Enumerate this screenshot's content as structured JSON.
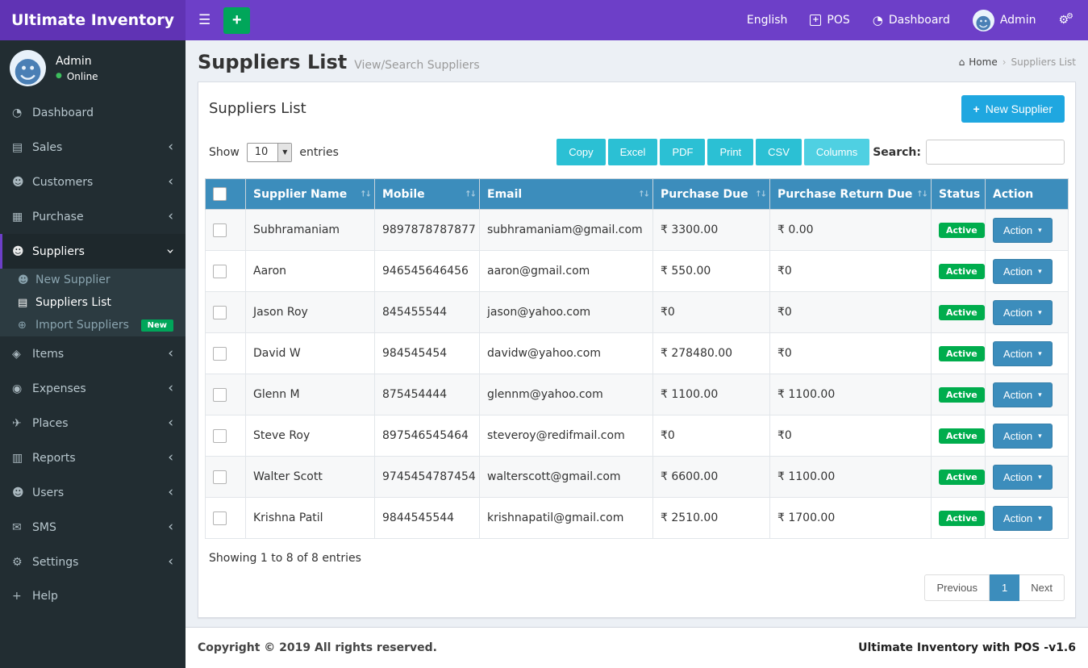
{
  "colors": {
    "navbar": "#6d3fc8",
    "brand_bg": "#6033b4",
    "sidebar_bg": "#222d32",
    "accent_blue": "#3c8dbc",
    "export_teal": "#2bc0d4",
    "success_green": "#00a65a",
    "new_supplier_blue": "#1fa7e0",
    "badge_green": "#00ad4d"
  },
  "icons": {
    "hamburger": "☰",
    "plus": "+",
    "user": "☻",
    "gear": "⚙",
    "home": "⌂",
    "breadcrumb_sep": "›",
    "chevron": "‹",
    "caret_down": "▾",
    "sort": "↑↓",
    "online_dot": "●",
    "select_arrow": "▼"
  },
  "brand": {
    "title": "Ultimate Inventory"
  },
  "navbar": {
    "language": "English",
    "pos_label": "POS",
    "dashboard_label": "Dashboard",
    "user_name": "Admin"
  },
  "sidebar": {
    "user": {
      "name": "Admin",
      "status": "Online"
    },
    "items": [
      {
        "label": "Dashboard",
        "icon": "◔"
      },
      {
        "label": "Sales",
        "icon": "▤"
      },
      {
        "label": "Customers",
        "icon": "☻"
      },
      {
        "label": "Purchase",
        "icon": "▦"
      },
      {
        "label": "Suppliers",
        "icon": "☻"
      },
      {
        "label": "Items",
        "icon": "◈"
      },
      {
        "label": "Expenses",
        "icon": "◉"
      },
      {
        "label": "Places",
        "icon": "✈"
      },
      {
        "label": "Reports",
        "icon": "▥"
      },
      {
        "label": "Users",
        "icon": "☻"
      },
      {
        "label": "SMS",
        "icon": "✉"
      },
      {
        "label": "Settings",
        "icon": "⚙"
      },
      {
        "label": "Help",
        "icon": "+"
      }
    ],
    "suppliers_submenu": [
      {
        "label": "New Supplier",
        "icon": "☻"
      },
      {
        "label": "Suppliers List",
        "icon": "▤"
      },
      {
        "label": "Import Suppliers",
        "icon": "⊕",
        "badge": "New"
      }
    ]
  },
  "page": {
    "title": "Suppliers List",
    "subtitle": "View/Search Suppliers",
    "breadcrumb": {
      "home": "Home",
      "current": "Suppliers List"
    }
  },
  "card": {
    "title": "Suppliers List",
    "new_supplier_label": "New Supplier"
  },
  "controls": {
    "show_label": "Show",
    "entries_label": "entries",
    "page_length": "10",
    "export_buttons": [
      "Copy",
      "Excel",
      "PDF",
      "Print",
      "CSV",
      "Columns"
    ],
    "search_label": "Search:"
  },
  "table": {
    "headers": [
      "Supplier Name",
      "Mobile",
      "Email",
      "Purchase Due",
      "Purchase Return Due",
      "Status",
      "Action"
    ],
    "rows": [
      {
        "name": "Subhramaniam",
        "mobile": "9897878787877",
        "email": "subhramaniam@gmail.com",
        "purchase_due": "₹ 3300.00",
        "purchase_return_due": "₹ 0.00",
        "status": "Active",
        "action": "Action"
      },
      {
        "name": "Aaron",
        "mobile": "946545646456",
        "email": "aaron@gmail.com",
        "purchase_due": "₹ 550.00",
        "purchase_return_due": "₹0",
        "status": "Active",
        "action": "Action"
      },
      {
        "name": "Jason Roy",
        "mobile": "845455544",
        "email": "jason@yahoo.com",
        "purchase_due": "₹0",
        "purchase_return_due": "₹0",
        "status": "Active",
        "action": "Action"
      },
      {
        "name": "David W",
        "mobile": "984545454",
        "email": "davidw@yahoo.com",
        "purchase_due": "₹ 278480.00",
        "purchase_return_due": "₹0",
        "status": "Active",
        "action": "Action"
      },
      {
        "name": "Glenn M",
        "mobile": "875454444",
        "email": "glennm@yahoo.com",
        "purchase_due": "₹ 1100.00",
        "purchase_return_due": "₹ 1100.00",
        "status": "Active",
        "action": "Action"
      },
      {
        "name": "Steve Roy",
        "mobile": "897546545464",
        "email": "steveroy@redifmail.com",
        "purchase_due": "₹0",
        "purchase_return_due": "₹0",
        "status": "Active",
        "action": "Action"
      },
      {
        "name": "Walter Scott",
        "mobile": "9745454787454",
        "email": "walterscott@gmail.com",
        "purchase_due": "₹ 6600.00",
        "purchase_return_due": "₹ 1100.00",
        "status": "Active",
        "action": "Action"
      },
      {
        "name": "Krishna Patil",
        "mobile": "9844545544",
        "email": "krishnapatil@gmail.com",
        "purchase_due": "₹ 2510.00",
        "purchase_return_due": "₹ 1700.00",
        "status": "Active",
        "action": "Action"
      }
    ],
    "summary": "Showing 1 to 8 of 8 entries",
    "pagination": {
      "previous": "Previous",
      "current": "1",
      "next": "Next"
    }
  },
  "footer": {
    "copyright": "Copyright © 2019 All rights reserved.",
    "version": "Ultimate Inventory with POS -v1.6"
  }
}
